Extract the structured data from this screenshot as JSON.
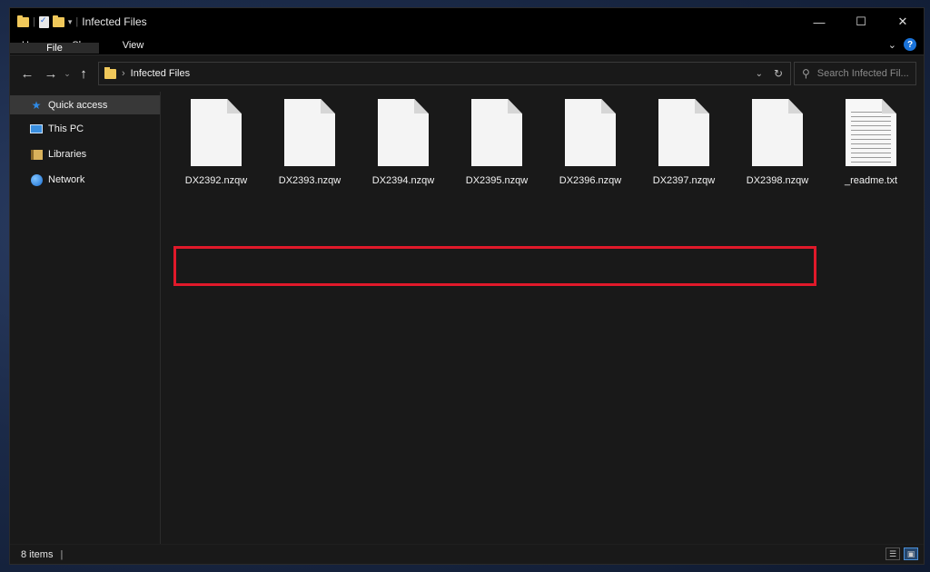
{
  "window": {
    "title": "Infected Files",
    "controls": {
      "minimize": "—",
      "maximize": "☐",
      "close": "✕"
    }
  },
  "ribbon": {
    "tabs": [
      "File",
      "Home",
      "Share",
      "View"
    ],
    "collapse_icon": "chevron-down-icon",
    "help_icon": "?"
  },
  "nav": {
    "back_icon": "←",
    "forward_icon": "→",
    "recent_icon": "⌄",
    "up_icon": "↑",
    "separator": "›",
    "path": "Infected Files",
    "dropdown_icon": "⌄",
    "refresh_icon": "↻"
  },
  "search": {
    "placeholder": "Search Infected Fil...",
    "icon": "⚲"
  },
  "sidebar": {
    "items": [
      {
        "label": "Quick access",
        "icon": "star-icon",
        "active": true
      },
      {
        "label": "This PC",
        "icon": "computer-icon",
        "active": false
      },
      {
        "label": "Libraries",
        "icon": "libraries-icon",
        "active": false
      },
      {
        "label": "Network",
        "icon": "network-icon",
        "active": false
      }
    ]
  },
  "files": [
    {
      "name": "DX2392.nzqw",
      "type": "blank"
    },
    {
      "name": "DX2393.nzqw",
      "type": "blank"
    },
    {
      "name": "DX2394.nzqw",
      "type": "blank"
    },
    {
      "name": "DX2395.nzqw",
      "type": "blank"
    },
    {
      "name": "DX2396.nzqw",
      "type": "blank"
    },
    {
      "name": "DX2397.nzqw",
      "type": "blank"
    },
    {
      "name": "DX2398.nzqw",
      "type": "blank"
    },
    {
      "name": "_readme.txt",
      "type": "text"
    }
  ],
  "status": {
    "count": "8 items"
  },
  "colors": {
    "highlight_box": "#e0192a",
    "folder": "#f0c85a",
    "accent": "#2e8ae6"
  }
}
